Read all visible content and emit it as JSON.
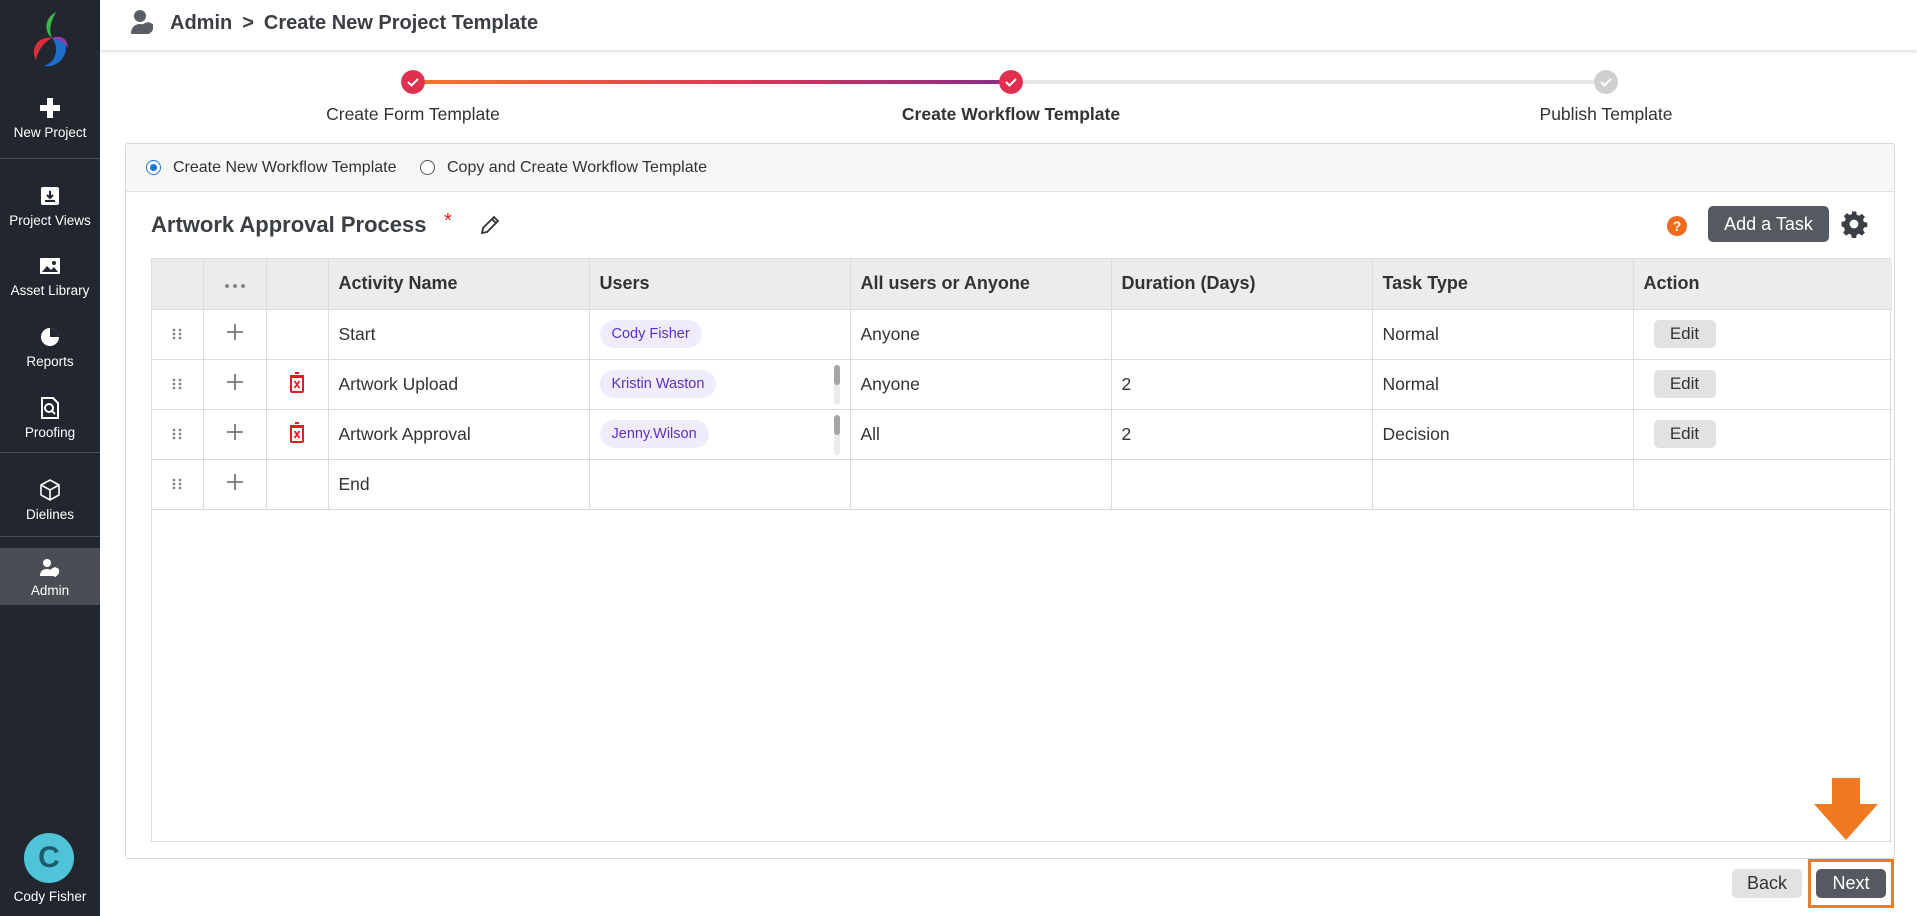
{
  "sidebar": {
    "items": [
      {
        "label": "New Project",
        "icon": "plus-icon"
      },
      {
        "label": "Project Views",
        "icon": "project-views-icon"
      },
      {
        "label": "Asset Library",
        "icon": "image-icon"
      },
      {
        "label": "Reports",
        "icon": "pie-chart-icon"
      },
      {
        "label": "Proofing",
        "icon": "proofing-icon"
      },
      {
        "label": "Dielines",
        "icon": "box-icon"
      },
      {
        "label": "Admin",
        "icon": "admin-icon",
        "active": true
      }
    ],
    "user": {
      "initial": "C",
      "name": "Cody Fisher"
    }
  },
  "header": {
    "section": "Admin",
    "separator": ">",
    "title": "Create New Project Template"
  },
  "stepper": {
    "steps": [
      {
        "label": "Create Form Template",
        "state": "done"
      },
      {
        "label": "Create Workflow Template",
        "state": "current"
      },
      {
        "label": "Publish Template",
        "state": "pending"
      }
    ]
  },
  "options": {
    "create_new": "Create New Workflow Template",
    "copy_create": "Copy and Create Workflow Template",
    "selected": "create_new"
  },
  "workflow": {
    "title": "Artwork Approval Process",
    "required_mark": "*",
    "help": "?",
    "add_task_label": "Add a Task"
  },
  "table": {
    "columns": [
      "Activity Name",
      "Users",
      "All users or Anyone",
      "Duration (Days)",
      "Task Type",
      "Action"
    ],
    "rows": [
      {
        "activity": "Start",
        "user": "Cody Fisher",
        "assign": "Anyone",
        "duration": "",
        "task_type": "Normal",
        "action": "Edit",
        "deletable": false
      },
      {
        "activity": "Artwork Upload",
        "user": "Kristin Waston",
        "assign": "Anyone",
        "duration": "2",
        "task_type": "Normal",
        "action": "Edit",
        "deletable": true
      },
      {
        "activity": "Artwork Approval",
        "user": "Jenny.Wilson",
        "assign": "All",
        "duration": "2",
        "task_type": "Decision",
        "action": "Edit",
        "deletable": true
      },
      {
        "activity": "End",
        "user": "",
        "assign": "",
        "duration": "",
        "task_type": "",
        "action": "",
        "deletable": false
      }
    ]
  },
  "footer": {
    "back_label": "Back",
    "next_label": "Next"
  },
  "colors": {
    "sidebar_bg": "#22262e",
    "accent_orange": "#f07a22",
    "step_done": "#e0304e",
    "step_pending": "#cfcfcf",
    "chip_text": "#5b2fc9"
  }
}
